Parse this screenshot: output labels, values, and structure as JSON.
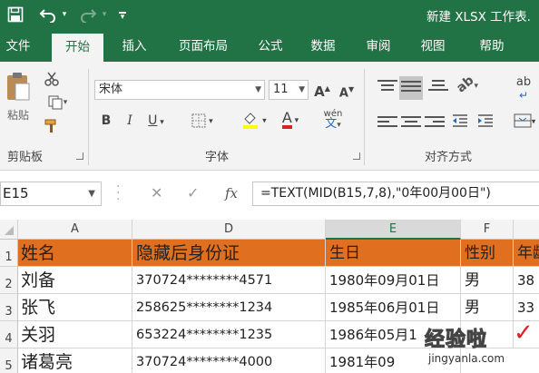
{
  "app": {
    "title": "新建 XLSX 工作表.",
    "qat": {
      "save_icon": "save-icon",
      "undo_icon": "undo-icon",
      "redo_icon": "redo-icon",
      "customize_icon": "customize-qat-icon"
    }
  },
  "tabs": [
    "文件",
    "开始",
    "插入",
    "页面布局",
    "公式",
    "数据",
    "审阅",
    "视图",
    "帮助"
  ],
  "active_tab": "开始",
  "ribbon": {
    "clipboard": {
      "paste_label": "粘贴",
      "group_label": "剪贴板"
    },
    "font": {
      "font_name": "宋体",
      "font_size": "11",
      "grow_label": "A",
      "shrink_label": "A",
      "bold_label": "B",
      "italic_label": "I",
      "underline_label": "U",
      "font_color_label": "A",
      "phonetic_label": "wén",
      "group_label": "字体"
    },
    "alignment": {
      "wrap_label": "ab",
      "group_label": "对齐方式"
    }
  },
  "formula_bar": {
    "name_box": "E15",
    "fx_label": "fx",
    "formula": "=TEXT(MID(B15,7,8),\"0年00月00日\")"
  },
  "sheet": {
    "columns": [
      "A",
      "D",
      "E",
      "F"
    ],
    "selected_column": "E",
    "rows": [
      {
        "num": "1",
        "cells": [
          "姓名",
          "隐藏后身份证",
          "生日",
          "性别",
          "年龄"
        ]
      },
      {
        "num": "2",
        "cells": [
          "刘备",
          "370724********4571",
          "1980年09月01日",
          "男",
          "38"
        ]
      },
      {
        "num": "3",
        "cells": [
          "张飞",
          "258625********1234",
          "1985年06月01日",
          "男",
          "33"
        ]
      },
      {
        "num": "4",
        "cells": [
          "关羽",
          "653224********1235",
          "1986年05月1",
          "",
          ""
        ]
      },
      {
        "num": "5",
        "cells": [
          "诸葛亮",
          "370724********4000",
          "1981年09",
          "",
          ""
        ]
      }
    ]
  },
  "watermark": {
    "text": "经验啦",
    "url": "jingyanla.com",
    "brand_color": "#e02020"
  }
}
